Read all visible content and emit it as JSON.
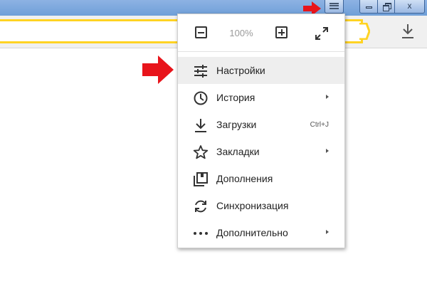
{
  "window": {
    "minimize_glyph": "",
    "close_glyph": "x"
  },
  "menu": {
    "zoom": {
      "level": "100%"
    },
    "items": [
      {
        "label": "Настройки",
        "icon": "settings-sliders-icon",
        "shortcut": "",
        "submenu": false,
        "highlighted": true
      },
      {
        "label": "История",
        "icon": "clock-icon",
        "shortcut": "",
        "submenu": true,
        "highlighted": false
      },
      {
        "label": "Загрузки",
        "icon": "download-icon",
        "shortcut": "Ctrl+J",
        "submenu": false,
        "highlighted": false
      },
      {
        "label": "Закладки",
        "icon": "star-icon",
        "shortcut": "",
        "submenu": true,
        "highlighted": false
      },
      {
        "label": "Дополнения",
        "icon": "extensions-icon",
        "shortcut": "",
        "submenu": false,
        "highlighted": false
      },
      {
        "label": "Синхронизация",
        "icon": "sync-icon",
        "shortcut": "",
        "submenu": false,
        "highlighted": false
      },
      {
        "label": "Дополнительно",
        "icon": "more-dots-icon",
        "shortcut": "",
        "submenu": true,
        "highlighted": false
      }
    ]
  },
  "colors": {
    "address_bar_border": "#ffd323",
    "annotation_arrow": "#e8141b",
    "title_bar": "#7ca8dd",
    "highlight_row": "#eeeeee"
  }
}
